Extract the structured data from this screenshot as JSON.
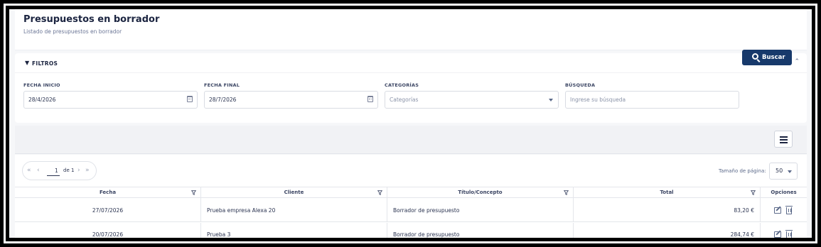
{
  "header": {
    "title": "Presupuestos en borrador",
    "subtitle": "Listado de presupuestos en borrador"
  },
  "filters": {
    "title": "FILTROS",
    "fecha_inicio": {
      "label": "FECHA INICIO",
      "value": "28/4/2026"
    },
    "fecha_final": {
      "label": "FECHA FINAL",
      "value": "28/7/2026"
    },
    "categorias": {
      "label": "CATEGORÍAS",
      "placeholder": "Categorías"
    },
    "busqueda": {
      "label": "BÚSQUEDA",
      "placeholder": "Ingrese su búsqueda"
    },
    "search_button": "Buscar"
  },
  "pagination": {
    "page": "1",
    "of_text": "de 1",
    "page_size_label": "Tamaño de página:",
    "page_size": "50"
  },
  "table": {
    "columns": [
      "Fecha",
      "Cliente",
      "Título/Concepto",
      "Total",
      "Opciones"
    ],
    "rows": [
      {
        "fecha": "27/07/2026",
        "cliente": "Prueba empresa Alexa 20",
        "titulo": "Borrador de presupuesto",
        "total": "83,20 €"
      },
      {
        "fecha": "20/07/2026",
        "cliente": "Prueba 3",
        "titulo": "Borrador de presupuesto",
        "total": "284,74 €"
      }
    ]
  },
  "colors": {
    "primary": "#17396b",
    "text": "#1b2440",
    "muted": "#6b7696"
  },
  "icons": [
    "filter-icon",
    "chevron-up-icon",
    "calendar-icon",
    "chevron-down-icon",
    "search-icon",
    "menu-icon",
    "first-page-icon",
    "prev-page-icon",
    "next-page-icon",
    "last-page-icon",
    "funnel-icon",
    "edit-icon",
    "trash-icon"
  ]
}
